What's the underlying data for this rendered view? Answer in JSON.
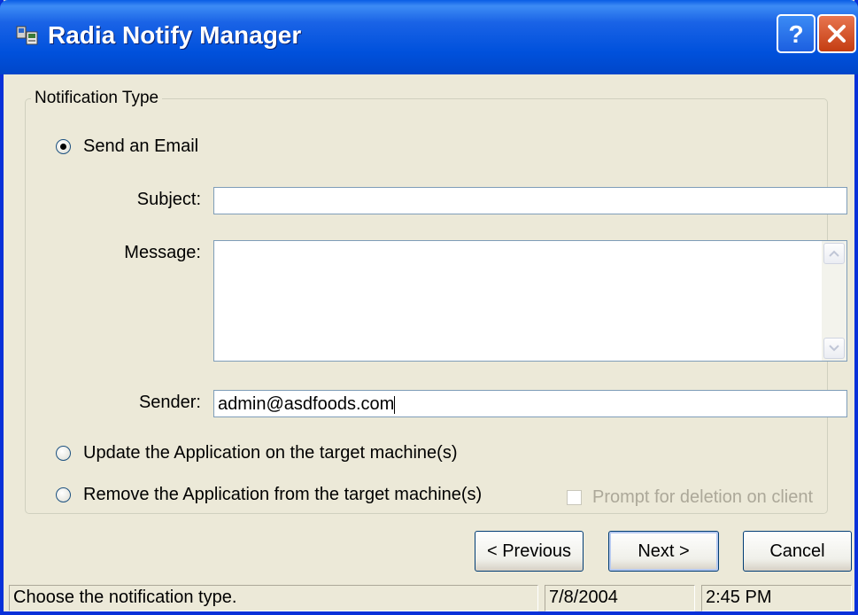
{
  "window": {
    "title": "Radia Notify Manager",
    "icons": {
      "app": "app-icon",
      "help": "help-icon",
      "close": "close-icon"
    },
    "colors": {
      "titlebar": "#0054e3",
      "close": "#e04a1f",
      "face": "#ece9d8"
    }
  },
  "group": {
    "legend": "Notification Type",
    "options": [
      {
        "label": "Send an Email",
        "checked": true
      },
      {
        "label": "Update the Application on the target machine(s)",
        "checked": false
      },
      {
        "label": "Remove the Application from the target machine(s)",
        "checked": false
      }
    ],
    "subject_label": "Subject:",
    "subject_value": "",
    "message_label": "Message:",
    "message_value": "",
    "sender_label": "Sender:",
    "sender_value": "admin@asdfoods.com",
    "prompt_checkbox": {
      "label": "Prompt for deletion on client",
      "checked": false,
      "enabled": false
    }
  },
  "buttons": {
    "previous": "< Previous",
    "next": "Next >",
    "cancel": "Cancel"
  },
  "status": {
    "message": "Choose the notification type.",
    "date": "7/8/2004",
    "time": "2:45 PM"
  }
}
